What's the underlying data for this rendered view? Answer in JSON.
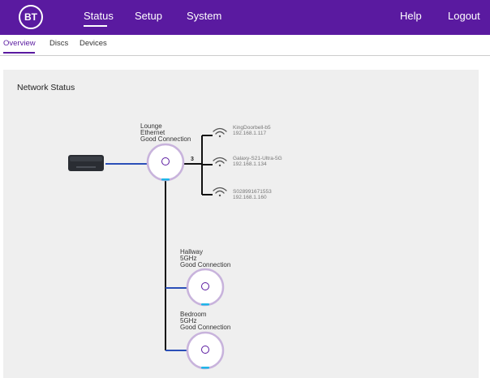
{
  "brand": {
    "logo_text": "BT"
  },
  "top_nav": {
    "items": [
      "Status",
      "Setup",
      "System"
    ],
    "active": "Status",
    "help_label": "Help",
    "logout_label": "Logout"
  },
  "sub_nav": {
    "items": [
      "Overview",
      "Discs",
      "Devices"
    ],
    "active": "Overview"
  },
  "panel": {
    "title": "Network Status"
  },
  "discs": {
    "lounge": {
      "name": "Lounge",
      "link": "Ethernet",
      "status": "Good Connection",
      "device_count": "3"
    },
    "hallway": {
      "name": "Hallway",
      "link": "5GHz",
      "status": "Good Connection"
    },
    "bedroom": {
      "name": "Bedroom",
      "link": "5GHz",
      "status": "Good Connection"
    }
  },
  "devices": [
    {
      "name": "KingDoorbell-b5",
      "ip": "192.168.1.117"
    },
    {
      "name": "Galaxy-S21-Ultra-5G",
      "ip": "192.168.1.134"
    },
    {
      "name": "S028991671553",
      "ip": "192.168.1.160"
    }
  ],
  "colors": {
    "brand_purple": "#5a1aa0",
    "link_blue": "#2b4fb8",
    "disc_ring": "#c8b3dc",
    "panel_bg": "#efefef"
  },
  "icons": {
    "wifi": "wifi-icon",
    "router": "router-icon",
    "disc": "bt-disc-icon"
  }
}
